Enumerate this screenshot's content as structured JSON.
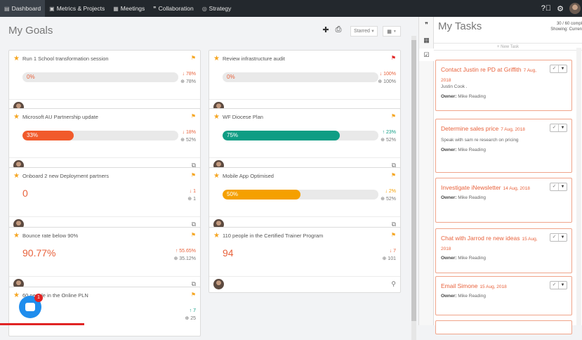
{
  "nav": {
    "items": [
      {
        "label": "Dashboard",
        "icon": "dashboard-icon",
        "active": true
      },
      {
        "label": "Metrics & Projects",
        "icon": "briefcase-icon"
      },
      {
        "label": "Meetings",
        "icon": "calendar-icon"
      },
      {
        "label": "Collaboration",
        "icon": "chat-icon"
      },
      {
        "label": "Strategy",
        "icon": "target-icon"
      }
    ],
    "right_icons": [
      "help-icon",
      "gear-icon",
      "user-avatar"
    ]
  },
  "goals": {
    "title": "My Goals",
    "filter_selected": "Starred",
    "cards": [
      {
        "name": "Run 1 School transformation session",
        "flag": "orange",
        "display": "bar",
        "progress": 0,
        "label": "0%",
        "fill": "#e8623c",
        "stat1": "↓ 78%",
        "stat2": "⊕ 78%",
        "footer_icon": ""
      },
      {
        "name": "Review infrastructure audit",
        "flag": "red",
        "display": "bar",
        "progress": 0,
        "label": "0%",
        "fill": "#e8623c",
        "stat1": "↓ 100%",
        "stat2": "⊕ 100%",
        "footer_icon": ""
      },
      {
        "name": "Microsoft AU Partnership update",
        "flag": "orange",
        "display": "bar",
        "progress": 0.33,
        "label": "33%",
        "fill": "#f15a2b",
        "stat1": "↓ 18%",
        "stat2": "⊕ 52%",
        "footer_icon": "comments-icon"
      },
      {
        "name": "WF Diocese Plan",
        "flag": "orange",
        "display": "bar",
        "progress": 0.75,
        "label": "75%",
        "fill": "#0f9d84",
        "stat1": "↑ 23%",
        "stat2": "⊕ 52%",
        "stat1_up": true,
        "footer_icon": "comments-icon"
      },
      {
        "name": "Onboard 2 new Deployment partners",
        "flag": "orange",
        "display": "value",
        "label": "0",
        "stat1": "↓ 1",
        "stat2": "⊕ 1",
        "footer_icon": "comments-icon"
      },
      {
        "name": "Mobile App Optimised",
        "flag": "orange",
        "display": "bar",
        "progress": 0.5,
        "label": "50%",
        "fill": "#f5a000",
        "stat1": "↓ 2%",
        "stat2": "⊕ 52%",
        "stat1_warn": true,
        "footer_icon": "comments-icon"
      },
      {
        "name": "Bounce rate below 90%",
        "flag": "orange",
        "display": "value",
        "label": "90.77%",
        "stat1": "↑ 55.65%",
        "stat2": "⊕ 35.12%",
        "footer_icon": "comments-icon"
      },
      {
        "name": "110 people in the Certified Trainer Program",
        "flag": "orange",
        "display": "value",
        "label": "94",
        "stat1": "↓ 7",
        "stat2": "⊕ 101",
        "footer_icon": "hierarchy-icon"
      },
      {
        "name": "60 people in the Online PLN",
        "flag": "orange",
        "display": "none",
        "label": "",
        "stat1": "↑ 7",
        "stat2": "⊕ 25",
        "stat1_up": true,
        "footer_icon": ""
      }
    ]
  },
  "tasks": {
    "title": "My Tasks",
    "count": "30 / 60 compl",
    "showing": "Showing: Curren",
    "new_task": "+ New Task",
    "owner_label": "Owner:",
    "items": [
      {
        "title": "Contact Justin re PD at Griffith",
        "date": "7 Aug, 2018",
        "desc": "Justin Cook .",
        "owner": "Mike Reading"
      },
      {
        "title": "Determine sales price",
        "date": "7 Aug, 2018",
        "desc": "Speak with sam re research on pricing",
        "owner": "Mike Reading"
      },
      {
        "title": "Investigate iNewsletter",
        "date": "14 Aug, 2018",
        "desc": "",
        "owner": "Mike Reading"
      },
      {
        "title": "Chat with Jarrod re new ideas",
        "date": "15 Aug, 2018",
        "desc": "",
        "owner": "Mike Reading"
      },
      {
        "title": "Email Simone",
        "date": "15 Aug, 2018",
        "desc": "",
        "owner": "Mike Reading"
      }
    ]
  },
  "chat": {
    "badge": "1"
  }
}
